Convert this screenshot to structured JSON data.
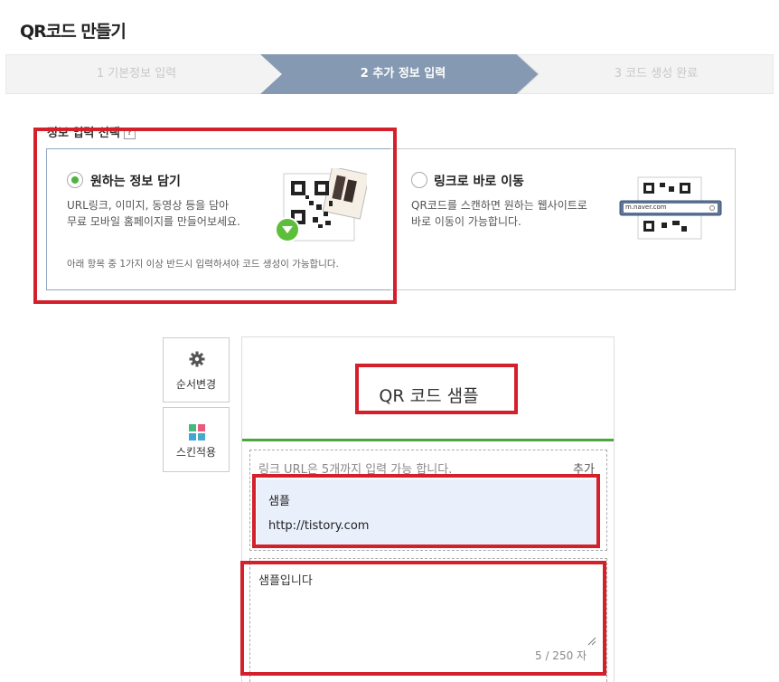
{
  "page_title": "QR코드 만들기",
  "steps": [
    {
      "label": "1 기본정보 입력",
      "state": "done"
    },
    {
      "label": "2 추가 정보 입력",
      "state": "active"
    },
    {
      "label": "3 코드 생성 완료",
      "state": "pending"
    }
  ],
  "info_select": {
    "label": "정보 입력 선택",
    "help_icon": "?",
    "options": [
      {
        "title": "원하는 정보 담기",
        "desc_line1": "URL링크, 이미지, 동영상 등을 담아",
        "desc_line2": "무료 모바일 홈페이지를 만들어보세요.",
        "note": "아래 항목 중 1가지 이상 반드시 입력하셔야 코드 생성이 가능합니다.",
        "selected": true
      },
      {
        "title": "링크로 바로 이동",
        "desc_line1": "QR코드를 스캔하면 원하는 웹사이트로",
        "desc_line2": "바로 이동이 가능합니다.",
        "url_sample": "m.naver.com",
        "selected": false
      }
    ]
  },
  "tools": [
    {
      "label": "순서변경",
      "icon": "gear-icon"
    },
    {
      "label": "스킨적용",
      "icon": "skin-grid-icon"
    }
  ],
  "preview": {
    "title": "QR 코드 샘플",
    "link_hint": "링크 URL은 5개까지 입력 가능 합니다.",
    "link_add": "추가",
    "link_item": {
      "name": "샘플",
      "url": "http://tistory.com"
    },
    "text_content": "샘플입니다",
    "text_counter": "5 / 250 자"
  },
  "colors": {
    "accent_green": "#4aa73b",
    "highlight_red": "#d4202a",
    "step_active": "#7f93ad",
    "link_bg": "#e9effb"
  }
}
